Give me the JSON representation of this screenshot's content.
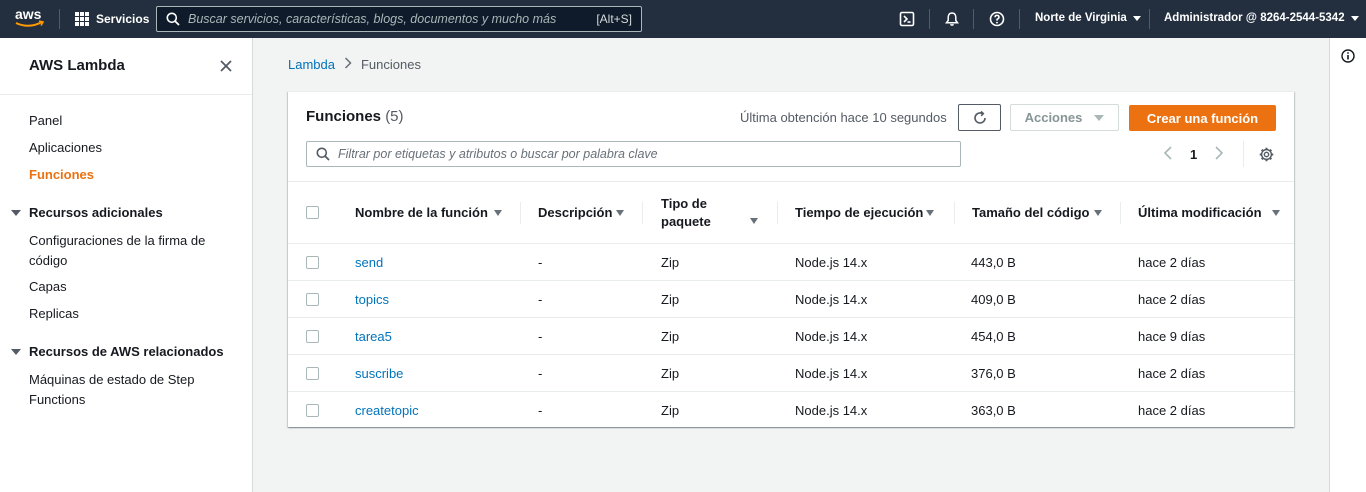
{
  "topnav": {
    "logo_text": "aws",
    "services_label": "Servicios",
    "search_placeholder": "Buscar servicios, características, blogs, documentos y mucho más",
    "search_shortcut": "[Alt+S]",
    "region": "Norte de Virginia",
    "account": "Administrador @ 8264-2544-5342"
  },
  "sidebar": {
    "title": "AWS Lambda",
    "items": [
      "Panel",
      "Aplicaciones",
      "Funciones"
    ],
    "active_item": "Funciones",
    "section_additional": {
      "label": "Recursos adicionales",
      "items": [
        "Configuraciones de la firma de código",
        "Capas",
        "Replicas"
      ]
    },
    "section_related": {
      "label": "Recursos de AWS relacionados",
      "items": [
        "Máquinas de estado de Step Functions"
      ]
    }
  },
  "breadcrumb": {
    "parent": "Lambda",
    "current": "Funciones"
  },
  "panel": {
    "title": "Funciones",
    "count": "(5)",
    "last_fetched": "Última obtención hace 10 segundos",
    "actions_label": "Acciones",
    "create_label": "Crear una función",
    "filter_placeholder": "Filtrar por etiquetas y atributos o buscar por palabra clave",
    "page": "1"
  },
  "table": {
    "columns": [
      "Nombre de la función",
      "Descripción",
      "Tipo de paquete",
      "Tiempo de ejecución",
      "Tamaño del código",
      "Última modificación"
    ],
    "rows": [
      [
        "send",
        "-",
        "Zip",
        "Node.js 14.x",
        "443,0 B",
        "hace 2 días"
      ],
      [
        "topics",
        "-",
        "Zip",
        "Node.js 14.x",
        "409,0 B",
        "hace 2 días"
      ],
      [
        "tarea5",
        "-",
        "Zip",
        "Node.js 14.x",
        "454,0 B",
        "hace 9 días"
      ],
      [
        "suscribe",
        "-",
        "Zip",
        "Node.js 14.x",
        "376,0 B",
        "hace 2 días"
      ],
      [
        "createtopic",
        "-",
        "Zip",
        "Node.js 14.x",
        "363,0 B",
        "hace 2 días"
      ]
    ]
  },
  "colors": {
    "nav_bg": "#232f3e",
    "accent_orange": "#ec7211",
    "link_blue": "#0073bb"
  }
}
